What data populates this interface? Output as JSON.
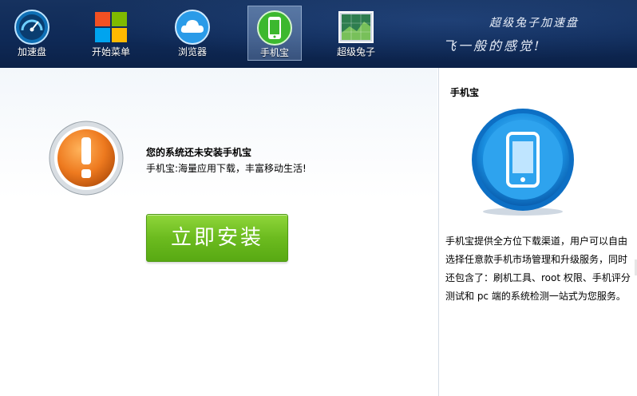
{
  "toolbar": {
    "items": [
      {
        "label": "加速盘",
        "icon": "speed-gauge-icon",
        "active": false
      },
      {
        "label": "开始菜单",
        "icon": "windows-logo-icon",
        "active": false
      },
      {
        "label": "浏览器",
        "icon": "cloud-icon",
        "active": false
      },
      {
        "label": "手机宝",
        "icon": "mobile-phone-icon",
        "active": true
      },
      {
        "label": "超级兔子",
        "icon": "super-rabbit-icon",
        "active": false
      }
    ],
    "slogan_line1": "超级兔子加速盘",
    "slogan_line2": "飞一般的感觉!"
  },
  "main": {
    "message_title": "您的系统还未安装手机宝",
    "message_subtitle": "手机宝:海量应用下载，丰富移动生活!",
    "install_button": "立即安装"
  },
  "side": {
    "title": "手机宝",
    "description": "手机宝提供全方位下载渠道，用户可以自由选择任意款手机市场管理和升级服务，同时还包含了：刷机工具、root 权限、手机评分测试和 pc 端的系统检测一站式为您服务。"
  },
  "colors": {
    "toolbar_bg": "#0f2a57",
    "install_green": "#6cbb1f",
    "warning_orange": "#e8741a",
    "phone_blue": "#1a8fe0"
  }
}
